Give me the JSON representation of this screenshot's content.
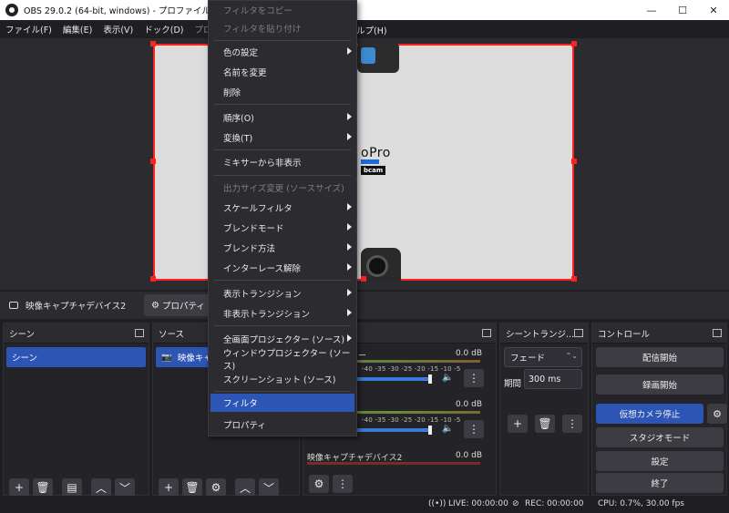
{
  "window": {
    "title": "OBS 29.0.2 (64-bit, windows) - プロファイル: 無題 - シーン",
    "minimize": "—",
    "maximize": "☐",
    "close": "✕"
  },
  "menubar": {
    "file": "ファイル(F)",
    "edit": "編集(E)",
    "view": "表示(V)",
    "dock": "ドック(D)",
    "profile": "プロファイル",
    "help": "ルプ(H)"
  },
  "preview": {
    "brand": "oPro",
    "brand_sub": "bcam"
  },
  "source_toolbar": {
    "source_name": "映像キャプチャデバイス2",
    "properties_label": "プロパティ"
  },
  "context_menu": {
    "items": [
      {
        "label": "フィルタをコピー",
        "disabled": true
      },
      {
        "label": "フィルタを貼り付け",
        "disabled": true
      },
      {
        "label": "色の設定",
        "submenu": true
      },
      {
        "label": "名前を変更"
      },
      {
        "label": "削除"
      },
      {
        "label": "順序(O)",
        "submenu": true
      },
      {
        "label": "変換(T)",
        "submenu": true
      },
      {
        "label": "ミキサーから非表示"
      },
      {
        "label": "出力サイズ変更 (ソースサイズ)",
        "disabled": true
      },
      {
        "label": "スケールフィルタ",
        "submenu": true
      },
      {
        "label": "ブレンドモード",
        "submenu": true
      },
      {
        "label": "ブレンド方法",
        "submenu": true
      },
      {
        "label": "インターレース解除",
        "submenu": true
      },
      {
        "label": "表示トランジション",
        "submenu": true
      },
      {
        "label": "非表示トランジション",
        "submenu": true
      },
      {
        "label": "全画面プロジェクター (ソース)",
        "submenu": true
      },
      {
        "label": "ウィンドウプロジェクター (ソース)"
      },
      {
        "label": "スクリーンショット (ソース)"
      },
      {
        "label": "フィルタ",
        "selected": true
      },
      {
        "label": "プロパティ"
      }
    ]
  },
  "scenes": {
    "title": "シーン",
    "items": [
      "シーン"
    ]
  },
  "sources": {
    "title": "ソース",
    "items": [
      "映像キャプ"
    ]
  },
  "mixer": {
    "title_fragment": "ー",
    "tracks": [
      {
        "name": "ー",
        "db": "0.0 dB"
      },
      {
        "name": "",
        "db": "0.0 dB"
      },
      {
        "name": "映像キャプチャデバイス2",
        "db": "0.0 dB"
      }
    ],
    "ticks": "-40 -35 -30 -25 -20 -15 -10 -5"
  },
  "transitions": {
    "title": "シーントランジ...",
    "selected": "フェード",
    "duration_label": "期間",
    "duration_value": "300 ms"
  },
  "controls": {
    "title": "コントロール",
    "start_streaming": "配信開始",
    "start_recording": "録画開始",
    "stop_virtual_camera": "仮想カメラ停止",
    "studio_mode": "スタジオモード",
    "settings": "設定",
    "exit": "終了"
  },
  "status": {
    "live": "LIVE: 00:00:00",
    "rec": "REC: 00:00:00",
    "cpu": "CPU: 0.7%, 30.00 fps"
  },
  "colors": {
    "accent": "#2d55b6",
    "selection_border": "#ff2020"
  }
}
